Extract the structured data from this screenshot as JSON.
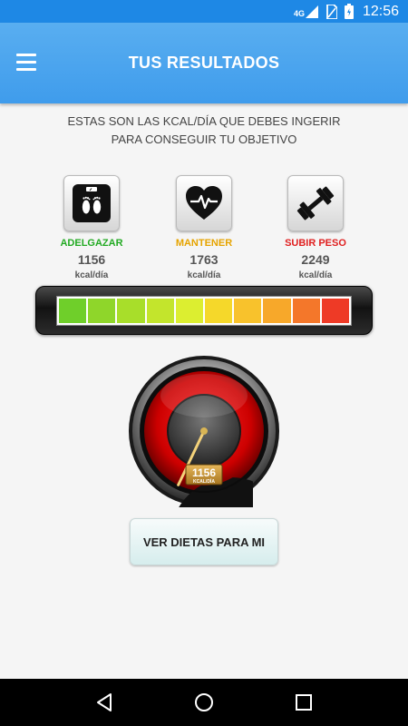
{
  "status_bar": {
    "network": "4G",
    "time": "12:56"
  },
  "app_bar": {
    "title": "TUS RESULTADOS"
  },
  "intro": {
    "line1": "ESTAS SON LAS KCAL/DÍA QUE DEBES INGERIR",
    "line2": "PARA CONSEGUIR TU OBJETIVO"
  },
  "options": [
    {
      "label": "ADELGAZAR",
      "value": "1156",
      "unit": "kcal/día",
      "color": "#22aa22",
      "icon": "bathroom-scale-icon"
    },
    {
      "label": "MANTENER",
      "value": "1763",
      "unit": "kcal/día",
      "color": "#e6a400",
      "icon": "heart-pulse-icon"
    },
    {
      "label": "SUBIR PESO",
      "value": "2249",
      "unit": "kcal/día",
      "color": "#e02020",
      "icon": "dumbbell-icon"
    }
  ],
  "level_bar": {
    "colors": [
      "#6fcf2a",
      "#8fd62a",
      "#a8de2a",
      "#c3e52c",
      "#dcee30",
      "#f5d82a",
      "#f8c22c",
      "#f7a82a",
      "#f4772a",
      "#ee3a26"
    ]
  },
  "gauge": {
    "value": "1156",
    "unit": "KCAL/DÍA",
    "needle_level": 0.1
  },
  "actions": {
    "diet_button": "VER DIETAS PARA MI"
  },
  "nav_bar": {
    "back": "back-icon",
    "home": "home-icon",
    "recents": "recents-icon"
  }
}
